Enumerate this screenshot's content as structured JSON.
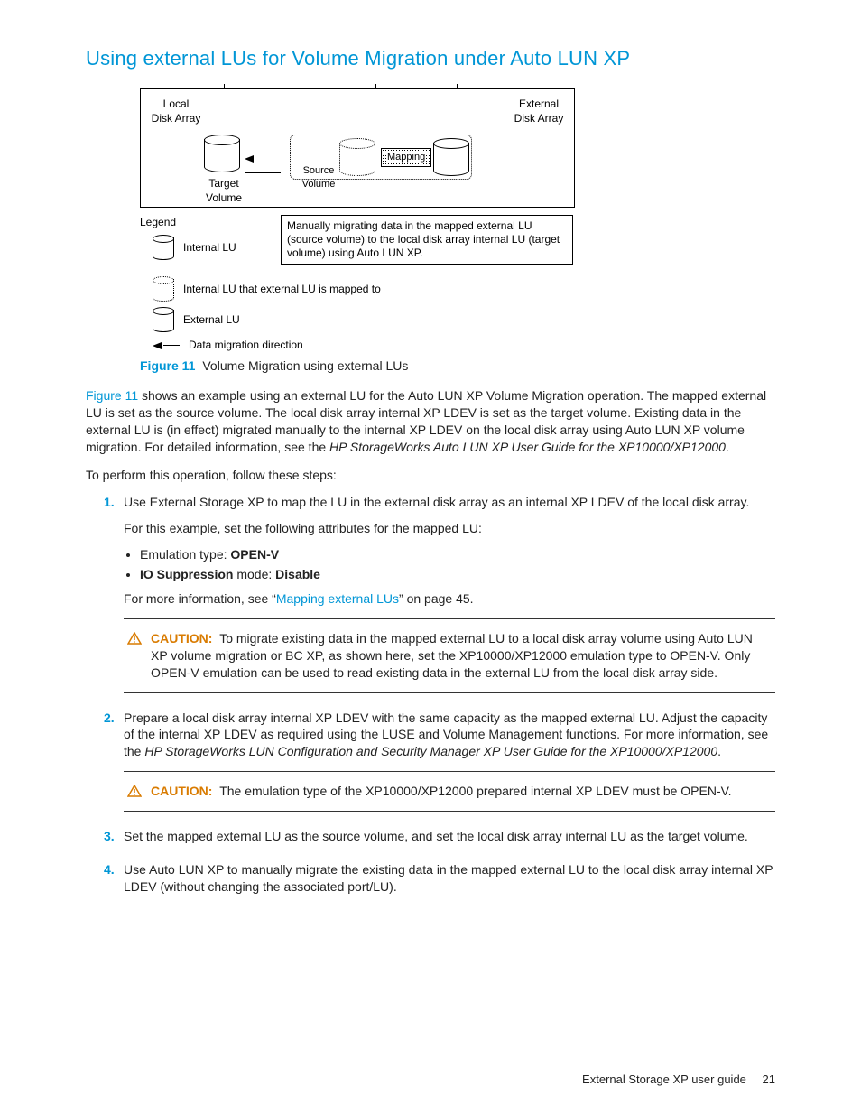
{
  "heading": "Using external LUs for Volume Migration under Auto LUN XP",
  "diagram": {
    "local_label": "Local\nDisk Array",
    "external_label": "External\nDisk Array",
    "target_label": "Target\nVolume",
    "source_label": "Source\nVolume",
    "mapping_label": "Mapping",
    "callout": "Manually migrating data in the mapped external LU (source volume) to the local disk array internal LU (target volume) using Auto LUN XP."
  },
  "legend": {
    "title": "Legend",
    "internal": "Internal LU",
    "mapped": "Internal LU that external LU is mapped to",
    "external": "External LU",
    "arrow": "Data migration direction"
  },
  "figure_caption_label": "Figure 11",
  "figure_caption_text": "Volume Migration using external LUs",
  "para1_a": "Figure 11",
  "para1_b": " shows an example using an external LU for the Auto LUN XP Volume Migration operation. The mapped external LU is set as the source volume. The local disk array internal XP LDEV is set as the target volume. Existing data in the external LU is (in effect) migrated manually to the internal XP LDEV on the local disk array using Auto LUN XP volume migration. For detailed information, see the ",
  "para1_c": "HP StorageWorks Auto LUN XP User Guide for the XP10000/XP12000",
  "para1_d": ".",
  "para2": "To perform this operation, follow these steps:",
  "steps": {
    "s1": {
      "num": "1.",
      "text": "Use External Storage XP to map the LU in the external disk array as an internal XP LDEV of the local disk array.",
      "sub_intro": "For this example, set the following attributes for the mapped LU:",
      "bullet1_a": "Emulation type: ",
      "bullet1_b": "OPEN-V",
      "bullet2_a": "IO Suppression",
      "bullet2_b": " mode: ",
      "bullet2_c": "Disable",
      "more_a": "For more information, see “",
      "more_link": "Mapping external LUs",
      "more_b": "” on page 45.",
      "caution_label": "CAUTION:",
      "caution_text": "To migrate existing data in the mapped external LU to a local disk array volume using Auto LUN XP volume migration or BC XP, as shown here, set the XP10000/XP12000 emulation type to OPEN-V. Only OPEN-V emulation can be used to read existing data in the external LU from the local disk array side."
    },
    "s2": {
      "num": "2.",
      "text_a": "Prepare a local disk array internal XP LDEV with the same capacity as the mapped external LU. Adjust the capacity of the internal XP LDEV as required using the LUSE and Volume Management functions. For more information, see the ",
      "text_b": "HP StorageWorks LUN Configuration and Security Manager XP User Guide for the XP10000/XP12000",
      "text_c": ".",
      "caution_label": "CAUTION:",
      "caution_text": "The emulation type of the XP10000/XP12000 prepared internal XP LDEV must be OPEN-V."
    },
    "s3": {
      "num": "3.",
      "text": "Set the mapped external LU as the source volume, and set the local disk array internal LU as the target volume."
    },
    "s4": {
      "num": "4.",
      "text": "Use Auto LUN XP to manually migrate the existing data in the mapped external LU to the local disk array internal XP LDEV (without changing the associated port/LU)."
    }
  },
  "footer_text": "External Storage XP user guide",
  "footer_page": "21"
}
